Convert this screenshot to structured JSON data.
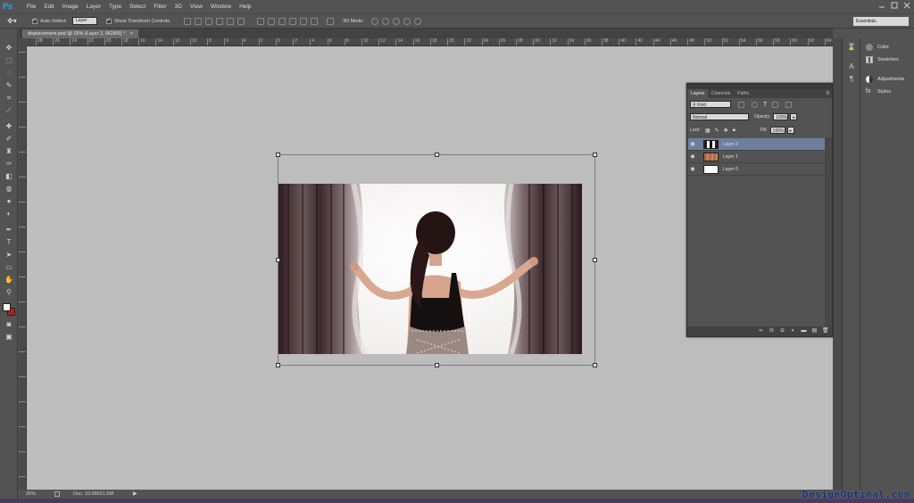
{
  "app": {
    "logo": "Ps"
  },
  "menu": [
    "File",
    "Edit",
    "Image",
    "Layer",
    "Type",
    "Select",
    "Filter",
    "3D",
    "View",
    "Window",
    "Help"
  ],
  "options": {
    "auto_select_label": "Auto-Select:",
    "auto_select_value": "Layer",
    "show_transform_label": "Show Transform Controls",
    "mode_3d_label": "3D Mode:",
    "workspace": "Essentials"
  },
  "document": {
    "tab_title": "displacement.psd @ 25% (Layer 2, RGB/8) *",
    "tab_close": "×"
  },
  "ruler": {
    "top_ticks": [
      "28",
      "26",
      "24",
      "22",
      "20",
      "18",
      "16",
      "14",
      "12",
      "10",
      "8",
      "6",
      "4",
      "2",
      "0",
      "2",
      "4",
      "6",
      "8",
      "10",
      "12",
      "14",
      "16",
      "18",
      "20",
      "22",
      "24",
      "26",
      "28",
      "30",
      "32",
      "34",
      "36",
      "38",
      "40",
      "42",
      "44",
      "46",
      "48",
      "50",
      "52",
      "54",
      "56",
      "58",
      "60",
      "62",
      "64"
    ]
  },
  "status": {
    "zoom": "25%",
    "doc_info": "Doc: 10.5M/31.5M"
  },
  "layers_panel": {
    "tabs": [
      "Layers",
      "Channels",
      "Paths"
    ],
    "filter_kind": "Kind",
    "blend_mode": "Normal",
    "opacity_label": "Opacity:",
    "opacity_value": "100%",
    "lock_label": "Lock:",
    "fill_label": "Fill:",
    "fill_value": "100%",
    "layers": [
      {
        "name": "Layer 2",
        "selected": true
      },
      {
        "name": "Layer 1",
        "selected": false
      },
      {
        "name": "Layer 0",
        "selected": false
      }
    ]
  },
  "right_dock": {
    "items": [
      "Color",
      "Swatches",
      "Adjustments",
      "Styles"
    ]
  },
  "watermark": "DesignOptimal.com",
  "colors": {
    "chrome": "#535353",
    "canvas_bg": "#bdbdbd",
    "selected_layer": "#6d7f9d",
    "ps_blue": "#2fa3e6"
  }
}
